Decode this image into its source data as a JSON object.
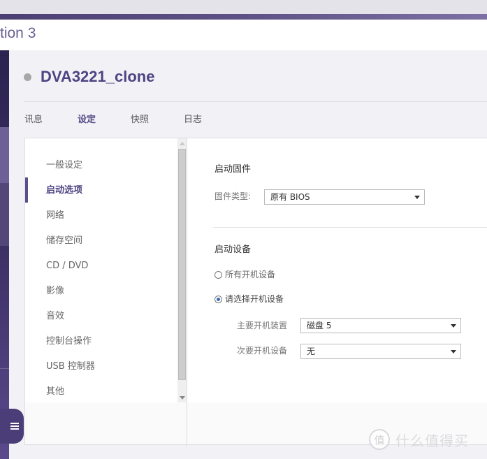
{
  "window": {
    "title_fragment": "tion 3"
  },
  "vm": {
    "name": "DVA3221_clone",
    "status": "stopped"
  },
  "tabs": [
    {
      "label": "讯息",
      "active": false
    },
    {
      "label": "设定",
      "active": true
    },
    {
      "label": "快照",
      "active": false
    },
    {
      "label": "日志",
      "active": false
    }
  ],
  "settings_nav": {
    "items": [
      {
        "label": "一般设定",
        "active": false
      },
      {
        "label": "启动选项",
        "active": true
      },
      {
        "label": "网络",
        "active": false
      },
      {
        "label": "储存空间",
        "active": false
      },
      {
        "label": "CD / DVD",
        "active": false
      },
      {
        "label": "影像",
        "active": false
      },
      {
        "label": "音效",
        "active": false
      },
      {
        "label": "控制台操作",
        "active": false
      },
      {
        "label": "USB 控制器",
        "active": false
      },
      {
        "label": "其他",
        "active": false
      }
    ]
  },
  "boot_firmware": {
    "section_title": "启动固件",
    "firmware_type_label": "固件类型:",
    "firmware_type_value": "原有 BIOS"
  },
  "boot_device": {
    "section_title": "启动设备",
    "options": [
      {
        "label": "所有开机设备",
        "checked": false
      },
      {
        "label": "请选择开机设备",
        "checked": true
      }
    ],
    "primary_label": "主要开机装置",
    "primary_value": "磁盘 5",
    "secondary_label": "次要开机设备",
    "secondary_value": "无"
  },
  "watermark": {
    "badge": "值",
    "text": "什么值得买"
  },
  "colors": {
    "accent": "#574b88",
    "radio_selected": "#3f6ab8"
  }
}
